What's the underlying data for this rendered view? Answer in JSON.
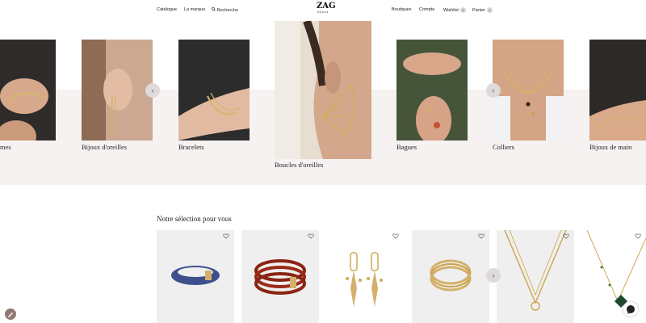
{
  "header": {
    "nav_left": [
      "Catalogue",
      "La marque",
      "Recherche"
    ],
    "nav_right": [
      "Boutiques",
      "Compte",
      "Wishlist",
      "Panier"
    ],
    "wishlist_count": "0",
    "cart_count": "0",
    "logo_text": "ZAG",
    "logo_subtext": "BIJOUX"
  },
  "categories": [
    {
      "label": "mes"
    },
    {
      "label": "Bijoux d'oreilles"
    },
    {
      "label": "Bracelets"
    },
    {
      "label": "Boucles d'oreilles"
    },
    {
      "label": "Bagues"
    },
    {
      "label": "Colliers"
    },
    {
      "label": "Bijoux de main"
    }
  ],
  "carousel": {
    "prev_icon": "‹",
    "next_icon": "›"
  },
  "selection": {
    "title": "Notre sélection pour vous",
    "next_icon": "›",
    "products": [
      {
        "icon": "blue-bangle"
      },
      {
        "icon": "red-bangles"
      },
      {
        "icon": "gold-earrings"
      },
      {
        "icon": "gold-bangle"
      },
      {
        "icon": "gold-necklace"
      },
      {
        "icon": "clover-necklace"
      }
    ]
  },
  "colors": {
    "accent": "#c9a24a",
    "band": "#f6f2f1"
  }
}
